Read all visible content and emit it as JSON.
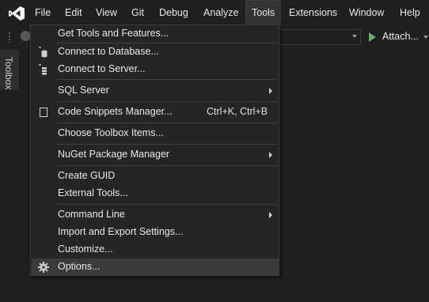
{
  "menubar": {
    "items": [
      "File",
      "Edit",
      "View",
      "Git",
      "Debug",
      "Analyze",
      "Tools",
      "Extensions",
      "Window",
      "Help"
    ]
  },
  "toolbar": {
    "attach_label": "Attach..."
  },
  "toolbox_label": "Toolbox",
  "tools_menu": {
    "items": [
      {
        "label": "Get Tools and Features...",
        "icon": null,
        "shortcut": "",
        "submenu": false
      },
      {
        "label": "Connect to Database...",
        "icon": "database-icon",
        "shortcut": "",
        "submenu": false
      },
      {
        "label": "Connect to Server...",
        "icon": "server-icon",
        "shortcut": "",
        "submenu": false
      },
      {
        "label": "SQL Server",
        "icon": null,
        "shortcut": "",
        "submenu": true
      },
      {
        "label": "Code Snippets Manager...",
        "icon": "snippet-icon",
        "shortcut": "Ctrl+K, Ctrl+B",
        "submenu": false
      },
      {
        "label": "Choose Toolbox Items...",
        "icon": null,
        "shortcut": "",
        "submenu": false
      },
      {
        "label": "NuGet Package Manager",
        "icon": null,
        "shortcut": "",
        "submenu": true
      },
      {
        "label": "Create GUID",
        "icon": null,
        "shortcut": "",
        "submenu": false
      },
      {
        "label": "External Tools...",
        "icon": null,
        "shortcut": "",
        "submenu": false
      },
      {
        "label": "Command Line",
        "icon": null,
        "shortcut": "",
        "submenu": true
      },
      {
        "label": "Import and Export Settings...",
        "icon": null,
        "shortcut": "",
        "submenu": false
      },
      {
        "label": "Customize...",
        "icon": null,
        "shortcut": "",
        "submenu": false
      },
      {
        "label": "Options...",
        "icon": "gear-icon",
        "shortcut": "",
        "submenu": false
      }
    ],
    "highlighted": "Options..."
  },
  "colors": {
    "background": "#1f1f1f",
    "menu_bg": "#252526",
    "hover": "#3a3a3a",
    "play_green": "#5cb85c",
    "vs_purple": "#ffffff"
  }
}
